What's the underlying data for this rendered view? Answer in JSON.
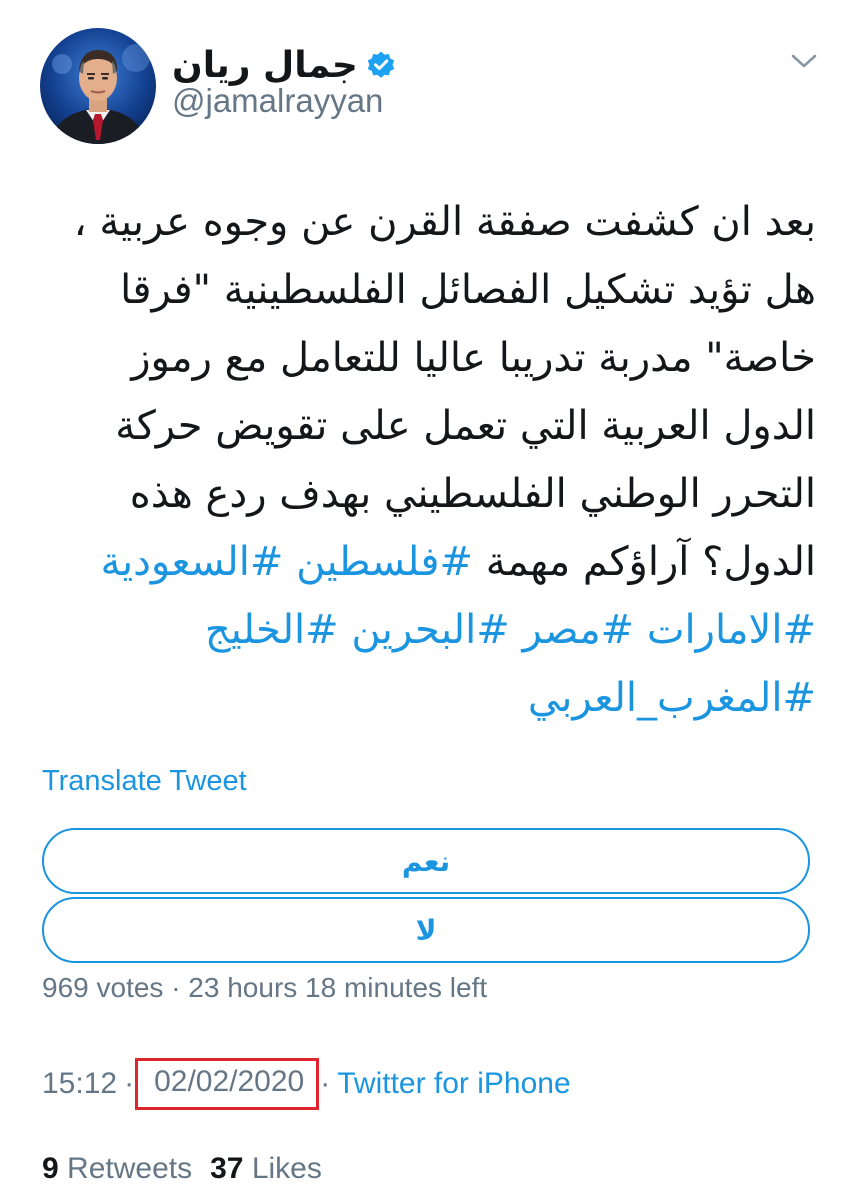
{
  "author": {
    "name": "جمال ريان",
    "handle": "@jamalrayyan",
    "verified": true,
    "verified_color": "#1da1f2"
  },
  "tweet": {
    "lines": [
      "بعد ان كشفت صفقة القرن عن وجوه عربية ،",
      "هل تؤيد تشكيل الفصائل الفلسطينية \"فرقا",
      "خاصة\" مدربة تدريبا عاليا للتعامل مع رموز",
      "الدول العربية التي تعمل على تقويض حركة",
      "التحرر الوطني الفلسطيني بهدف ردع هذه"
    ],
    "line6_text": "الدول؟ آراؤكم مهمة",
    "hashtags_line6": [
      "#فلسطين",
      "#السعودية"
    ],
    "hashtags_line7": [
      "#الامارات",
      "#مصر",
      "#البحرين",
      "#الخليج"
    ],
    "hashtags_line8": [
      "#المغرب_العربي"
    ],
    "translate_label": "Translate Tweet"
  },
  "poll": {
    "options": [
      "نعم",
      "لا"
    ],
    "meta": "969 votes · 23 hours 18 minutes left"
  },
  "meta": {
    "time": "15:12",
    "date": "02/02/2020",
    "source": "Twitter for iPhone",
    "highlight_color": "#e0262d"
  },
  "stats": {
    "retweets_count": "9",
    "retweets_label": "Retweets",
    "likes_count": "37",
    "likes_label": "Likes"
  },
  "colors": {
    "link": "#1b95e0",
    "text": "#14171a",
    "secondary": "#657786"
  }
}
